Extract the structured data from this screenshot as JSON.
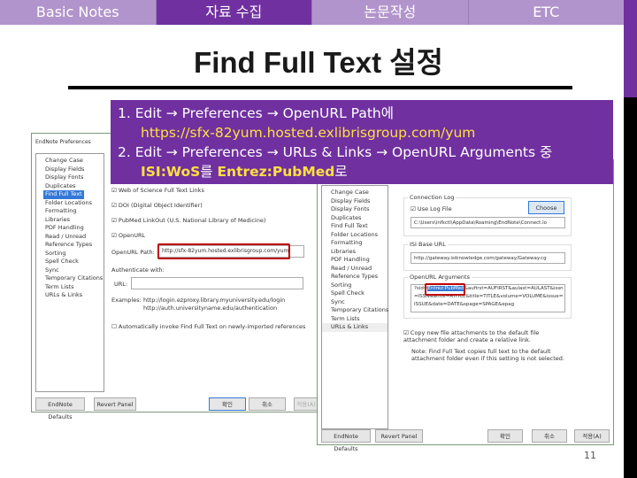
{
  "nav": {
    "tabs": [
      {
        "label": "Basic Notes"
      },
      {
        "label": "자료 수집",
        "active": true
      },
      {
        "label": "논문작성"
      },
      {
        "label": "ETC"
      }
    ]
  },
  "title": "Find Full Text 설정",
  "instructions": {
    "step1_num": "1.",
    "step1_text": "Edit → Preferences → OpenURL Path에",
    "step1_url": "https://sfx-82yum.hosted.exlibrisgroup.com/yum",
    "step2_num": "2.",
    "step2_text": "Edit → Preferences → URLs & Links → OpenURL Arguments 중",
    "step2_from": "ISI:WoS",
    "step2_mid": "를 ",
    "step2_to": "Entrez:PubMed",
    "step2_end": "로"
  },
  "tree": [
    "Change Case",
    "Display Fields",
    "Display Fonts",
    "Duplicates",
    "Find Full Text",
    "Folder Locations",
    "Formatting",
    "Libraries",
    "PDF Handling",
    "Read / Unread",
    "Reference Types",
    "Sorting",
    "Spell Check",
    "Sync",
    "Temporary Citations",
    "Term Lists",
    "URLs & Links"
  ],
  "left_dialog": {
    "title": "EndNote Preferences",
    "checks": [
      "Web of Science Full Text Links",
      "DOI (Digital Object Identifier)",
      "PubMed LinkOut (U.S. National Library of Medicine)",
      "OpenURL"
    ],
    "openurl_label": "OpenURL Path:",
    "openurl_value": "http://sfx-82yum.hosted.exlibrisgroup.com/yum",
    "auth_label": "Authenticate with:",
    "url_label": "URL:",
    "url_value": "",
    "examples_label": "Examples:",
    "example1": "http://login.ezproxy.library.myuniversity.edu/login",
    "example2": "http://auth.universityname.edu/authentication",
    "auto_invoke": "Automatically invoke Find Full Text on newly-imported references",
    "defaults": "EndNote Defaults",
    "revert": "Revert Panel",
    "ok": "확인",
    "cancel": "취소",
    "apply": "적용(A)"
  },
  "right_dialog": {
    "conn_log": "Connection Log",
    "use_log": "Use Log File",
    "choose": "Choose",
    "log_path": "C:\\Users\\infkctl\\AppData\\Roaming\\EndNote\\Connect.lo",
    "isi_label": "ISI Base URL",
    "isi_value": "http://gateway.isiknowledge.com/gateway/Gateway.cg",
    "args_label": "OpenURL Arguments",
    "args_pre": "?sid=",
    "args_sel": "Entrez:PubMed",
    "args_rest": "&aufirst=AUFIRST&aulast=AULAST&issn=ISSN&atitle=ATITLE&title=TITLE&volume=VOLUME&issue=ISSUE&date=DATE&spage=SPAGE&epag",
    "copy": "Copy new file attachments to the default file attachment folder and create a relative link.",
    "note": "Note: Find Full Text copies full text to the default attachment folder even if this setting is not selected.",
    "defaults": "EndNote Defaults",
    "revert": "Revert Panel",
    "ok": "확인",
    "cancel": "취소",
    "apply": "적용(A)"
  },
  "page_number": "11",
  "colors": {
    "accent": "#7030a0",
    "nav_light": "#b294cc",
    "highlight": "#ffe040",
    "callout": "#c00000"
  }
}
